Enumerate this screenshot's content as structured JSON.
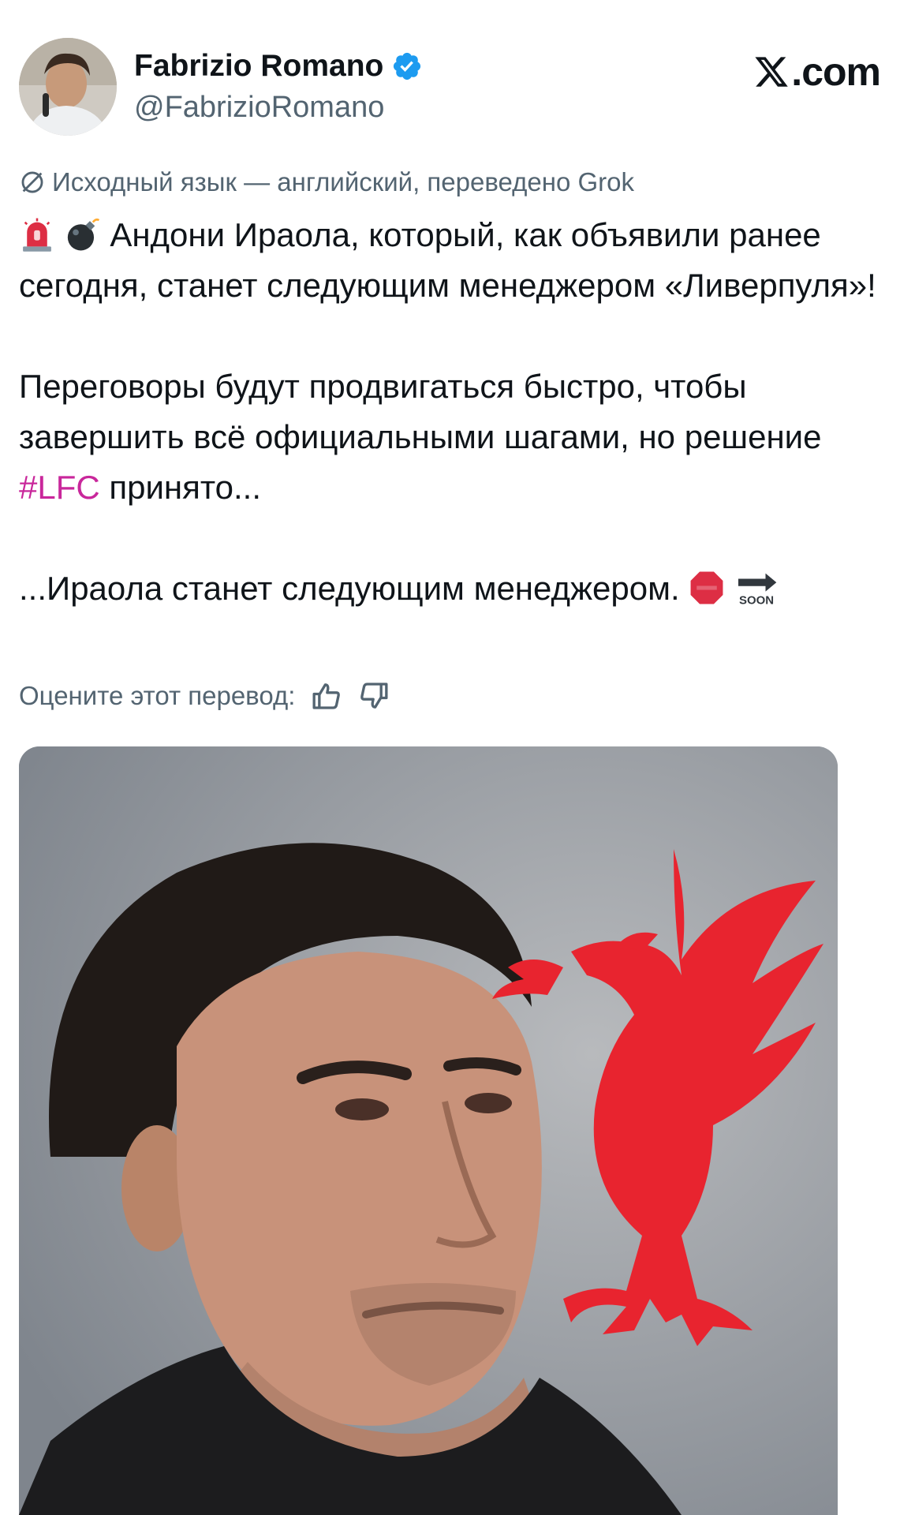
{
  "header": {
    "display_name": "Fabrizio Romano",
    "handle": "@FabrizioRomano",
    "site_label": ".com",
    "verified": true
  },
  "translation": {
    "note": "Исходный язык — английский, переведено Grok",
    "rate_label": "Оцените этот перевод:"
  },
  "tweet": {
    "line1": "Андони Ираола, который, как объявили ранее сегодня, станет следующим менеджером «Ливерпуля»!",
    "para2_before": "Переговоры будут продвигаться быстро, чтобы завершить всё официальными шагами, но решение ",
    "hashtag": "#LFC",
    "para2_after": " принято...",
    "para3": "...Ираола станет следующим менеджером.",
    "soon_label": "SOON"
  },
  "colors": {
    "text": "#0f1419",
    "secondary": "#536471",
    "verified": "#1d9bf0",
    "hashtag": "#c9279b",
    "liverbird": "#e8242f"
  },
  "icons": [
    "verified-badge-icon",
    "x-logo-icon",
    "globe-slash-icon",
    "siren-icon",
    "bomb-icon",
    "stop-sign-icon",
    "soon-arrow-icon",
    "thumbs-up-icon",
    "thumbs-down-icon"
  ]
}
